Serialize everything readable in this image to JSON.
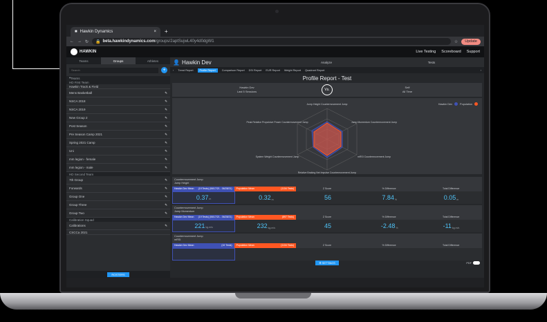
{
  "browser": {
    "tab_title": "Hawkin Dynamics",
    "url_host": "beta.hawkindynamics.com",
    "url_path": "/groups/2aptSujwL40y4d0dgW1",
    "update_label": "Update"
  },
  "app_header": {
    "logo_text": "HAWKIN",
    "links": [
      "Live Testing",
      "Scoreboard",
      "Support"
    ]
  },
  "sidebar": {
    "tabs": [
      "Teams",
      "Groups",
      "Athletes"
    ],
    "search_placeholder": "Search",
    "section_label": "Teams",
    "items": [
      {
        "label": "HD First Team",
        "type": "header"
      },
      {
        "label": "Hawkin Track & Field",
        "type": "small"
      },
      {
        "label": "Mens Basketball",
        "type": "item"
      },
      {
        "label": "NSCA 2018",
        "type": "item"
      },
      {
        "label": "NSCA 2019",
        "type": "item"
      },
      {
        "label": "New Group 2",
        "type": "item"
      },
      {
        "label": "Post Season",
        "type": "item"
      },
      {
        "label": "Pre Season Camp 2021",
        "type": "item"
      },
      {
        "label": "Spring 2021 Camp",
        "type": "item"
      },
      {
        "label": "Uni",
        "type": "item"
      },
      {
        "label": "mm legion - female",
        "type": "item"
      },
      {
        "label": "mm legion - male",
        "type": "item"
      },
      {
        "label": "HD Second Team",
        "type": "header"
      },
      {
        "label": "7th Group",
        "type": "item"
      },
      {
        "label": "Forwards",
        "type": "item"
      },
      {
        "label": "Group One",
        "type": "item"
      },
      {
        "label": "Group Three",
        "type": "item"
      },
      {
        "label": "Group Two",
        "type": "item"
      },
      {
        "label": "Calibration Squad",
        "type": "header"
      },
      {
        "label": "Calibrations",
        "type": "item"
      },
      {
        "label": "CSCCa 2021",
        "type": "small"
      }
    ],
    "rosters_label": "ROSTERS"
  },
  "main": {
    "athlete": "Hawkin Dev",
    "topic_tabs": [
      "Analyze",
      "Tests"
    ],
    "report_tabs": [
      "Trend Report",
      "Profile Report",
      "Comparison Report",
      "DSI Report",
      "EUR Report",
      "Weight Report",
      "Quadrant Report"
    ],
    "active_report": "Profile Report",
    "title": "Profile Report - Test",
    "left_compare": "Hawkin Dev",
    "left_sub": "Last 5 Sessions",
    "vs_label": "Vs.",
    "right_compare": "Self",
    "right_sub": "All Time",
    "legend": [
      "Hawkin Dev",
      "Population"
    ],
    "radar_labels": [
      "Jump Height Countermovement Jump",
      "Jump Momentum Countermovement Jump",
      "mRSI Countermovement Jump",
      "Relative Braking Net Impulse Countermovement Jump",
      "System Weight Countermovement Jump",
      "Peak Relative Propulsive Power Countermovement Jump"
    ],
    "metrics": [
      {
        "title": "Countermovement Jump",
        "subtitle": "Jump Height",
        "dev_head": "Hawkin Dev Mean",
        "dev_tests": "(19 Tests)",
        "dev_dates": "(06/17/21 - 06/28/21)",
        "pop_head": "Population Mean",
        "pop_tests": "(1134 Tests)",
        "cols": [
          "Z Score",
          "% Difference",
          "Total Difference"
        ],
        "dev_val": "0.37",
        "dev_unit": "m",
        "pop_val": "0.32",
        "pop_unit": "m",
        "z": "56",
        "pct": "7.84",
        "pct_unit": "%",
        "total": "0.05",
        "total_unit": "m"
      },
      {
        "title": "Countermovement Jump",
        "subtitle": "Jump Momentum",
        "dev_head": "Hawkin Dev Mean",
        "dev_tests": "(19 Tests)",
        "dev_dates": "(06/17/21 - 06/28/21)",
        "pop_head": "Population Mean",
        "pop_tests": "(897 Tests)",
        "cols": [
          "Z Score",
          "% Difference",
          "Total Difference"
        ],
        "dev_val": "221",
        "dev_unit": "kg.m/s",
        "pop_val": "232",
        "pop_unit": "kg.m/s",
        "z": "45",
        "pct": "-2.48",
        "pct_unit": "%",
        "total": "-11",
        "total_unit": "kg.m/s"
      },
      {
        "title": "Countermovement Jump",
        "subtitle": "mRSI",
        "dev_head": "Hawkin Dev Mean",
        "dev_tests": "(19 Tests)",
        "dev_dates": "",
        "pop_head": "Population Mean",
        "pop_tests": "(1134 Tests)",
        "cols": [
          "Z Score",
          "% Difference",
          "Total Difference"
        ],
        "dev_val": "",
        "dev_unit": "",
        "pop_val": "",
        "pop_unit": "",
        "z": "",
        "pct": "",
        "pct_unit": "",
        "total": "",
        "total_unit": ""
      }
    ],
    "settings_label": "SETTINGS",
    "pdf_label": "PDF"
  },
  "colors": {
    "dev": "#3f51b5",
    "population": "#ff5722",
    "accent": "#2196f3",
    "value": "#4fc3f7"
  }
}
